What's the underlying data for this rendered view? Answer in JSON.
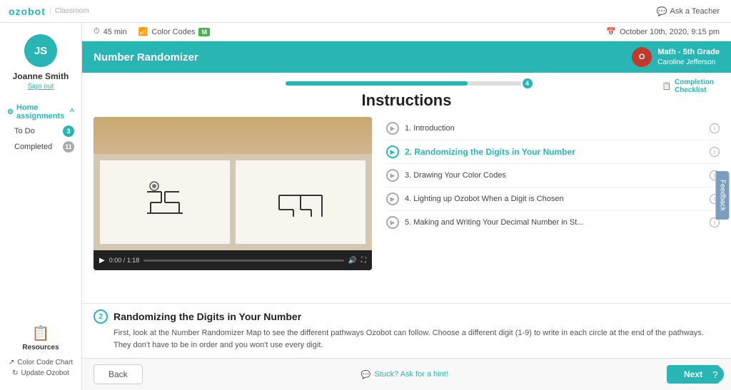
{
  "global_nav": {
    "logo": "ozobot",
    "logo_sub": "Classroom",
    "ask_teacher_label": "Ask a Teacher"
  },
  "sidebar": {
    "user": {
      "initials": "JS",
      "name": "Joanne Smith",
      "sign_out": "Sign out"
    },
    "section": {
      "label": "Home assignments",
      "chevron": "^"
    },
    "items": [
      {
        "label": "To Do",
        "badge": "3",
        "badge_type": "teal"
      },
      {
        "label": "Completed",
        "badge": "11",
        "badge_type": "gray"
      }
    ],
    "resources": {
      "label": "Resources",
      "links": [
        {
          "label": "Color Code Chart",
          "icon": "↗"
        },
        {
          "label": "Update Ozobot",
          "icon": "↻"
        }
      ]
    }
  },
  "top_meta": {
    "duration": "45 min",
    "type": "Color Codes",
    "badge": "M",
    "date": "October 10th, 2020, 9:15 pm"
  },
  "header": {
    "lesson_title": "Number Randomizer",
    "teacher": {
      "initials": "O",
      "grade": "Math - 5th Grade",
      "name": "Caroline Jefferson"
    }
  },
  "progress": {
    "step": "4",
    "completion_label": "Completion\nChecklist"
  },
  "instructions": {
    "heading": "Instructions"
  },
  "video": {
    "time": "0:00 / 1:18"
  },
  "steps": [
    {
      "num": "1",
      "label": "1. Introduction",
      "active": false
    },
    {
      "num": "2",
      "label": "2. Randomizing the Digits in Your Number",
      "active": true
    },
    {
      "num": "3",
      "label": "3. Drawing Your Color Codes",
      "active": false
    },
    {
      "num": "4",
      "label": "4. Lighting up Ozobot When a Digit is Chosen",
      "active": false
    },
    {
      "num": "5",
      "label": "5. Making and Writing Your Decimal Number in St...",
      "active": false
    }
  ],
  "description": {
    "step_num": "2",
    "title": "Randomizing the Digits in Your Number",
    "text": "First, look at the Number Randomizer Map to see the different pathways Ozobot can follow. Choose a different digit (1-9) to write in each circle at the end of the pathways. They don't have to be in order and you won't use every digit."
  },
  "bottom": {
    "back_label": "Back",
    "hint_label": "Stuck? Ask for a hint!",
    "next_label": "Next"
  },
  "feedback": {
    "label": "Feedback"
  },
  "help": {
    "symbol": "?"
  }
}
